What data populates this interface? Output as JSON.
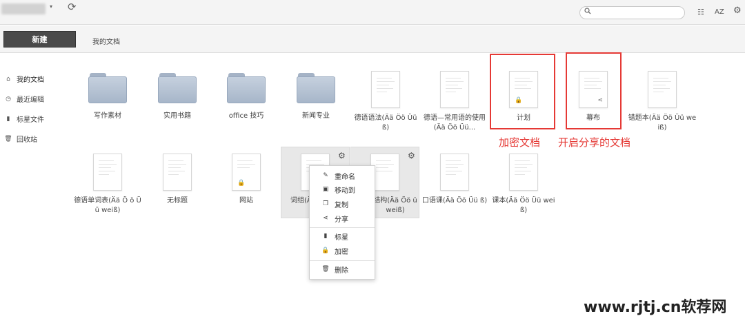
{
  "topbar": {
    "caret": "▾",
    "sync_icon": "sync-icon",
    "search": {
      "placeholder": "",
      "value": ""
    },
    "list_view_icon": "☷",
    "sort_label": "AZ",
    "settings_icon": "⚙"
  },
  "toolbar": {
    "new_button": "新建",
    "breadcrumb": "我的文档"
  },
  "sidebar": {
    "items": [
      {
        "label": "我的文档",
        "icon": "⌂"
      },
      {
        "label": "最近编辑",
        "icon": "◷"
      },
      {
        "label": "标星文件",
        "icon": "▮"
      },
      {
        "label": "回收站",
        "icon": "🗑"
      }
    ]
  },
  "grid": {
    "row1": [
      {
        "label": "写作素材",
        "kind": "folder"
      },
      {
        "label": "实用书籍",
        "kind": "folder"
      },
      {
        "label": "office 技巧",
        "kind": "folder"
      },
      {
        "label": "新闻专业",
        "kind": "folder"
      },
      {
        "label": "德语语法(Ää Öö Üü ß)",
        "kind": "doc"
      },
      {
        "label": "德语—常用语的使用(Ää Öö Üü...",
        "kind": "doc"
      },
      {
        "label": "计划",
        "kind": "doc",
        "badge": "🔒"
      },
      {
        "label": "幕布",
        "kind": "doc",
        "badge": "⋖"
      },
      {
        "label": "错题本(Ää Öö Üü weiß)",
        "kind": "doc"
      }
    ],
    "row2": [
      {
        "label": "德语单词表(Ää Ö ö Üü weiß)",
        "kind": "doc"
      },
      {
        "label": "无标题",
        "kind": "doc"
      },
      {
        "label": "网站",
        "kind": "doc",
        "badge": "🔒"
      },
      {
        "label": "词组(Ä",
        "kind": "doc"
      },
      {
        "label": "结构(Ää Öö ü weiß)",
        "kind": "doc"
      },
      {
        "label": "口语课(Ää Öö Üü ß)",
        "kind": "doc"
      },
      {
        "label": "课本(Ää Öö Üü weiß)",
        "kind": "doc"
      }
    ]
  },
  "context_menu": {
    "items": [
      {
        "label": "重命名",
        "icon": "✎"
      },
      {
        "label": "移动到",
        "icon": "▣"
      },
      {
        "label": "复制",
        "icon": "❐"
      },
      {
        "label": "分享",
        "icon": "⋖"
      },
      {
        "label": "标星",
        "icon": "▮"
      },
      {
        "label": "加密",
        "icon": "🔒"
      },
      {
        "label": "删除",
        "icon": "🗑"
      }
    ]
  },
  "annotations": {
    "encrypted": "加密文档",
    "shared": "开启分享的文档"
  },
  "watermark": "www.rjtj.cn软荐网",
  "colors": {
    "annotation": "#e53935",
    "new_button": "#4a4a4a"
  }
}
